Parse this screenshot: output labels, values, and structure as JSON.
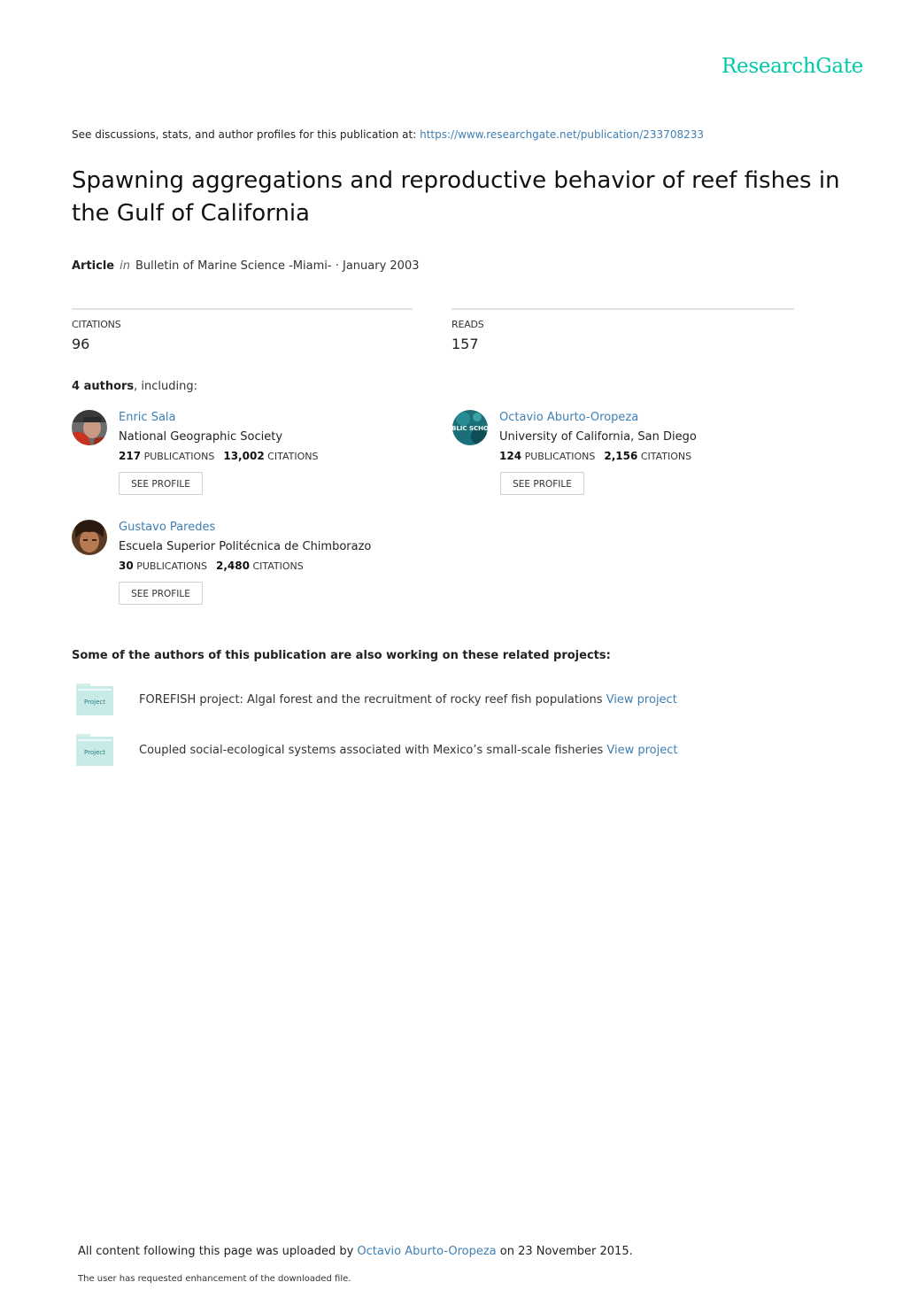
{
  "brand": {
    "logo_text": "ResearchGate",
    "color": "#00c9a7"
  },
  "header": {
    "see_prefix": "See discussions, stats, and author profiles for this publication at: ",
    "url": "https://www.researchgate.net/publication/233708233"
  },
  "publication": {
    "title": "Spawning aggregations and reproductive behavior of reef fishes in the Gulf of California",
    "type": "Article",
    "in_label": "in",
    "journal": "Bulletin of Marine Science -Miami-",
    "date_sep": " · ",
    "date": "January 2003"
  },
  "stats": {
    "citations_label": "CITATIONS",
    "citations_value": "96",
    "reads_label": "READS",
    "reads_value": "157"
  },
  "authors_header": {
    "count_text": "4 authors",
    "suffix": ", including:"
  },
  "authors": [
    {
      "name": "Enric Sala",
      "institution": "National Geographic Society",
      "publications": "217",
      "publications_label": "PUBLICATIONS",
      "citations": "13,002",
      "citations_label": "CITATIONS",
      "button_label": "SEE PROFILE",
      "avatar": "photo"
    },
    {
      "name": "Octavio Aburto-Oropeza",
      "institution": "University of California, San Diego",
      "publications": "124",
      "publications_label": "PUBLICATIONS",
      "citations": "2,156",
      "citations_label": "CITATIONS",
      "button_label": "SEE PROFILE",
      "avatar": "photo",
      "avatar_text": "BLIC SCHO"
    },
    {
      "name": "Gustavo Paredes",
      "institution": "Escuela Superior Politécnica de Chimborazo",
      "publications": "30",
      "publications_label": "PUBLICATIONS",
      "citations": "2,480",
      "citations_label": "CITATIONS",
      "button_label": "SEE PROFILE",
      "avatar": "photo"
    }
  ],
  "projects_header": "Some of the authors of this publication are also working on these related projects:",
  "projects": [
    {
      "icon_label": "Project",
      "title": "FOREFISH project: Algal forest and the recruitment of rocky reef fish populations",
      "link": "View project"
    },
    {
      "icon_label": "Project",
      "title": "Coupled social-ecological systems associated with Mexico’s small-scale fisheries",
      "link": "View project"
    }
  ],
  "footer": {
    "upload_prefix": "All content following this page was uploaded by ",
    "uploader": "Octavio Aburto-Oropeza",
    "upload_suffix": " on 23 November 2015.",
    "note": "The user has requested enhancement of the downloaded file."
  }
}
